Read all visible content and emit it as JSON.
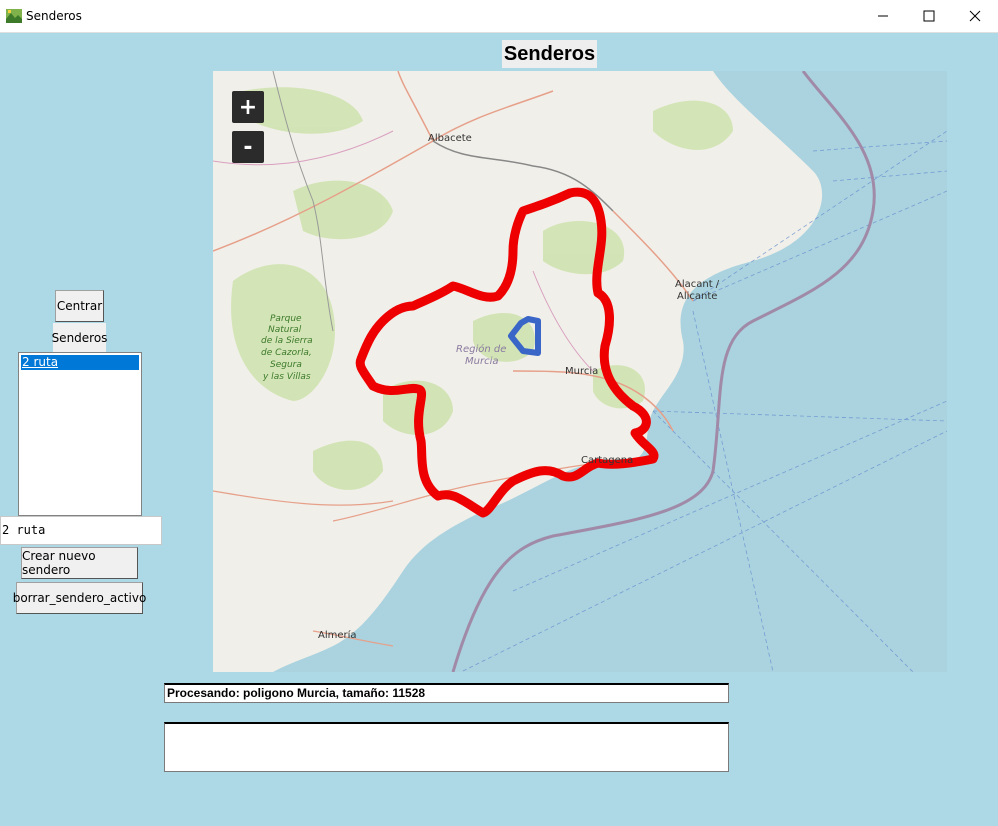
{
  "window": {
    "title": "Senderos"
  },
  "header": {
    "title": "Senderos"
  },
  "map": {
    "zoom_in": "+",
    "zoom_out": "-",
    "labels": {
      "albacete": "Albacete",
      "alicante1": "Alacant /",
      "alicante2": "Alicante",
      "murcia": "Murcia",
      "region1": "Región de",
      "region2": "Murcia",
      "cartagena": "Cartagena",
      "almeria": "Almería",
      "park1": "Parque",
      "park2": "Natural",
      "park3": "de la Sierra",
      "park4": "de Cazorla,",
      "park5": "Segura",
      "park6": "y las Villas"
    },
    "colors": {
      "polygon": "#ee0000",
      "route": "#3a66c8",
      "sea": "#aad3df",
      "land": "#f1efe9"
    }
  },
  "sidebar": {
    "centrar_label": "Centrar",
    "senderos_label": "Senderos",
    "list_items": [
      "2 ruta"
    ],
    "entry_value": "2 ruta",
    "create_label": "Crear nuevo sendero",
    "delete_label": "borrar_sendero_activo"
  },
  "status": {
    "text": "Procesando: poligono Murcia, tamaño: 11528"
  }
}
